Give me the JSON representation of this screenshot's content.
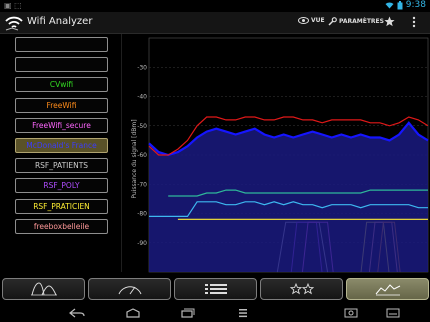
{
  "status_bar": {
    "time": "9:38"
  },
  "action_bar": {
    "title": "Wifi Analyzer",
    "view_label": "VUE",
    "settings_label": "PARAMÈTRES"
  },
  "networks": [
    {
      "name": "",
      "color": "#ffffff",
      "highlight": false
    },
    {
      "name": "",
      "color": "#ffffff",
      "highlight": false
    },
    {
      "name": "CVwifi",
      "color": "#33dd22",
      "highlight": false
    },
    {
      "name": "FreeWifi",
      "color": "#ff8c1a",
      "highlight": false
    },
    {
      "name": "FreeWifi_secure",
      "color": "#ff66ff",
      "highlight": false
    },
    {
      "name": "McDonald's France",
      "color": "#3b3bff",
      "highlight": true
    },
    {
      "name": "RSF_PATIENTS",
      "color": "#cccccc",
      "highlight": false
    },
    {
      "name": "RSF_POLY",
      "color": "#b04dff",
      "highlight": false
    },
    {
      "name": "RSF_PRATICIEN",
      "color": "#ffee33",
      "highlight": false
    },
    {
      "name": "freeboxbelleile",
      "color": "#ff9999",
      "highlight": false
    }
  ],
  "chart_data": {
    "type": "line",
    "ylabel": "Puissance du signal [dBm]",
    "yticks": [
      -30,
      -40,
      -50,
      -60,
      -70,
      -80,
      -90
    ],
    "ylim": [
      -100,
      -20
    ],
    "grid": true,
    "series": [
      {
        "name": "McDonald's France",
        "color": "#1515ff",
        "filled": true,
        "values": [
          -56,
          -59,
          -60,
          -59,
          -57,
          -54,
          -52,
          -51,
          -52,
          -53,
          -52,
          -51,
          -53,
          -54,
          -53,
          -54,
          -53,
          -52,
          -53,
          -54,
          -53,
          -54,
          -53,
          -54,
          -54,
          -55,
          -53,
          -49,
          -53,
          -55
        ]
      },
      {
        "name": "",
        "color": "#e01818",
        "filled": false,
        "values": [
          -57,
          -60,
          -60,
          -58,
          -55,
          -50,
          -47,
          -47,
          -48,
          -48,
          -47,
          -47,
          -48,
          -48,
          -47,
          -47,
          -48,
          -48,
          -49,
          -48,
          -48,
          -48,
          -48,
          -49,
          -49,
          -50,
          -49,
          -47,
          -48,
          -50
        ]
      },
      {
        "name": "",
        "color": "#2fb89a",
        "filled": false,
        "start": 2,
        "values": [
          null,
          null,
          -74,
          -74,
          -74,
          -74,
          -73,
          -73,
          -72,
          -72,
          -73,
          -73,
          -73,
          -73,
          -73,
          -73,
          -73,
          -73,
          -73,
          -73,
          -73,
          -73,
          -73,
          -72,
          -72,
          -72,
          -72,
          -72,
          -72,
          -72
        ]
      },
      {
        "name": "",
        "color": "#3db8f0",
        "filled": false,
        "values": [
          -81,
          -81,
          -81,
          -81,
          -81,
          -76,
          -76,
          -76,
          -77,
          -77,
          -76,
          -76,
          -77,
          -76,
          -77,
          -76,
          -77,
          -77,
          -78,
          -77,
          -77,
          -77,
          -78,
          -77,
          -77,
          -77,
          -77,
          -77,
          -78,
          -78
        ]
      },
      {
        "name": "",
        "color": "#ffee33",
        "filled": false,
        "values": [
          null,
          null,
          null,
          -82,
          -82,
          -82,
          -82,
          -82,
          -82,
          -82,
          -82,
          -82,
          -82,
          -82,
          -82,
          -82,
          -82,
          -82,
          -82,
          -82,
          -82,
          -82,
          -82,
          -82,
          -82,
          -82,
          -82,
          -82,
          -82,
          -82
        ]
      }
    ],
    "channel_shapes": [
      {
        "color": "#cccccc",
        "x": [
          0.46,
          0.49,
          0.61,
          0.64
        ]
      },
      {
        "color": "#b04dff",
        "x": [
          0.51,
          0.53,
          0.6,
          0.62
        ]
      },
      {
        "color": "#ff66ff",
        "x": [
          0.55,
          0.57,
          0.64,
          0.66
        ]
      },
      {
        "color": "#ffee33",
        "x": [
          0.76,
          0.78,
          0.84,
          0.86
        ]
      },
      {
        "color": "#ff9999",
        "x": [
          0.79,
          0.81,
          0.87,
          0.89
        ]
      },
      {
        "color": "#ff8c1a",
        "x": [
          0.82,
          0.84,
          0.88,
          0.9
        ]
      }
    ]
  },
  "tabs": [
    {
      "name": "tab-channel-graph",
      "icon": "channel-graph-icon",
      "active": false
    },
    {
      "name": "tab-channel-rating",
      "icon": "signal-meter-icon",
      "active": false
    },
    {
      "name": "tab-ap-list",
      "icon": "list-icon",
      "active": false
    },
    {
      "name": "tab-channel-rating-stars",
      "icon": "stars-icon",
      "active": false
    },
    {
      "name": "tab-time-graph",
      "icon": "time-graph-icon",
      "active": true
    }
  ]
}
